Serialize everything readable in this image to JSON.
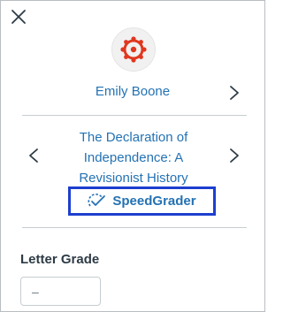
{
  "student": {
    "name": "Emily Boone"
  },
  "assignment": {
    "title": "The Declaration of Independence: A Revisionist History"
  },
  "speedgrader": {
    "label": "SpeedGrader"
  },
  "grade": {
    "label": "Letter Grade",
    "value": "–"
  },
  "colors": {
    "link": "#2472b3",
    "highlight_border": "#1d3fcf",
    "avatar_logo": "#e0371f"
  },
  "icons": {
    "close": "close-icon",
    "avatar": "canvas-logo-icon",
    "next_student": "chevron-right-icon",
    "prev_assignment": "chevron-left-icon",
    "next_assignment": "chevron-right-icon",
    "speedgrader": "speedgrader-icon"
  }
}
